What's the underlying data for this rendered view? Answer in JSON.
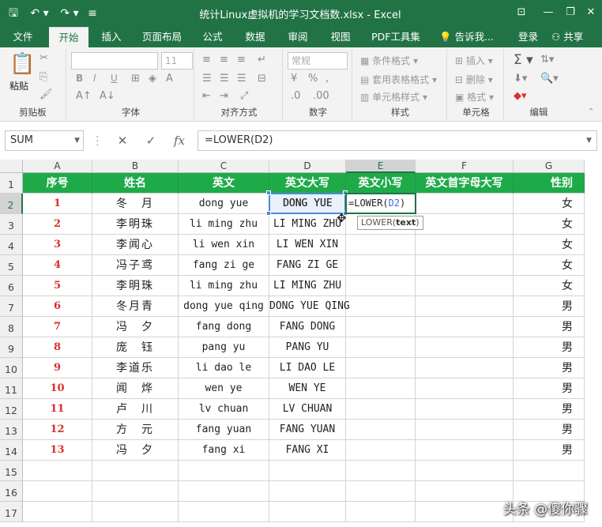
{
  "window": {
    "title": "统计Linux虚拟机的学习文档数.xlsx - Excel",
    "save_icon": "save-icon",
    "undo_icon": "undo-icon",
    "redo_icon": "redo-icon"
  },
  "menu": {
    "tabs": [
      "文件",
      "开始",
      "插入",
      "页面布局",
      "公式",
      "数据",
      "审阅",
      "视图",
      "PDF工具集"
    ],
    "active": "开始",
    "tell_me": "告诉我...",
    "login": "登录",
    "share": "共享"
  },
  "ribbon": {
    "clipboard": {
      "label": "剪贴板",
      "paste": "粘贴"
    },
    "font": {
      "label": "字体",
      "size": "11",
      "bold": "B",
      "italic": "I",
      "underline": "U"
    },
    "alignment": {
      "label": "对齐方式"
    },
    "number": {
      "label": "数字",
      "format": "常规"
    },
    "styles": {
      "label": "样式",
      "conditional": "条件格式",
      "table": "套用表格格式",
      "cell": "单元格样式"
    },
    "cells": {
      "label": "单元格",
      "insert": "插入",
      "delete": "删除",
      "format": "格式"
    },
    "editing": {
      "label": "编辑"
    }
  },
  "formula_bar": {
    "name_box": "SUM",
    "cancel": "✕",
    "enter": "✓",
    "fx": "fx",
    "formula": "=LOWER(D2)"
  },
  "sheet": {
    "columns": [
      "A",
      "B",
      "C",
      "D",
      "E",
      "F",
      "G"
    ],
    "rows": [
      "1",
      "2",
      "3",
      "4",
      "5",
      "6",
      "7",
      "8",
      "9",
      "10",
      "11",
      "12",
      "13",
      "14",
      "15",
      "16",
      "17"
    ],
    "header": [
      "序号",
      "姓名",
      "英文",
      "英文大写",
      "英文小写",
      "英文首字母大写",
      "性别"
    ],
    "data": [
      [
        "1",
        "冬　月",
        "dong yue",
        "DONG YUE",
        "",
        "",
        "女"
      ],
      [
        "2",
        "李明珠",
        "li ming zhu",
        "LI MING ZHU",
        "",
        "",
        "女"
      ],
      [
        "3",
        "李闻心",
        "li wen xin",
        "LI WEN XIN",
        "",
        "",
        "女"
      ],
      [
        "4",
        "冯子鸢",
        "fang zi ge",
        "FANG ZI GE",
        "",
        "",
        "女"
      ],
      [
        "5",
        "李明珠",
        "li ming zhu",
        "LI MING ZHU",
        "",
        "",
        "女"
      ],
      [
        "6",
        "冬月青",
        "dong yue qing",
        "DONG YUE QING",
        "",
        "",
        "男"
      ],
      [
        "7",
        "冯　夕",
        "fang dong",
        "FANG DONG",
        "",
        "",
        "男"
      ],
      [
        "8",
        "庞　钰",
        "pang yu",
        "PANG YU",
        "",
        "",
        "男"
      ],
      [
        "9",
        "李道乐",
        "li dao le",
        "LI DAO LE",
        "",
        "",
        "男"
      ],
      [
        "10",
        "闻　烨",
        "wen ye",
        "WEN YE",
        "",
        "",
        "男"
      ],
      [
        "11",
        "卢　川",
        "lv chuan",
        "LV CHUAN",
        "",
        "",
        "男"
      ],
      [
        "12",
        "方　元",
        "fang yuan",
        "FANG YUAN",
        "",
        "",
        "男"
      ],
      [
        "13",
        "冯　夕",
        "fang xi",
        "FANG XI",
        "",
        "",
        "男"
      ]
    ],
    "editing_cell": {
      "address": "E2",
      "prefix": "=LOWER(",
      "ref": "D2",
      "suffix": ")"
    },
    "tooltip": {
      "func": "LOWER(",
      "arg": "text",
      "close": ")"
    }
  },
  "watermark": "头条 @傻你骤",
  "colors": {
    "excel_green": "#217346",
    "header_fill": "#1faa4a",
    "number_red": "#d9302a"
  }
}
